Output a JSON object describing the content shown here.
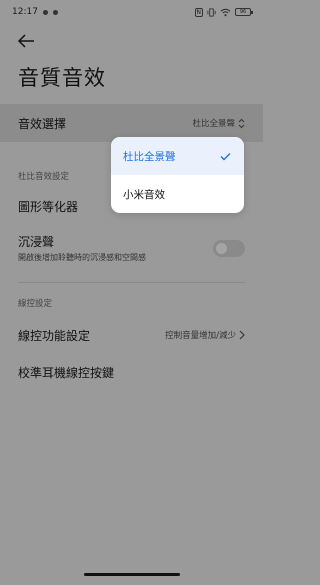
{
  "status_bar": {
    "time": "12:17",
    "battery": "96"
  },
  "header": {
    "title": "音質音效"
  },
  "sound_effect": {
    "label": "音效選擇",
    "value": "杜比全景聲"
  },
  "dolby_section": {
    "label": "杜比音效設定",
    "equalizer_label": "圖形等化器",
    "immersive_label": "沉浸聲",
    "immersive_desc": "開啟後增加聆聽時的沉浸感和空間感",
    "immersive_enabled": false
  },
  "wired_section": {
    "label": "線控設定",
    "function_label": "線控功能設定",
    "function_value": "控制音量增加/減少",
    "calibrate_label": "校準耳機線控按鍵"
  },
  "dropdown": {
    "options": [
      {
        "label": "杜比全景聲",
        "selected": true
      },
      {
        "label": "小米音效",
        "selected": false
      }
    ]
  },
  "colors": {
    "accent": "#1f6fe6",
    "dim_background": "#9a9a9a",
    "popup_background": "#ffffff"
  }
}
